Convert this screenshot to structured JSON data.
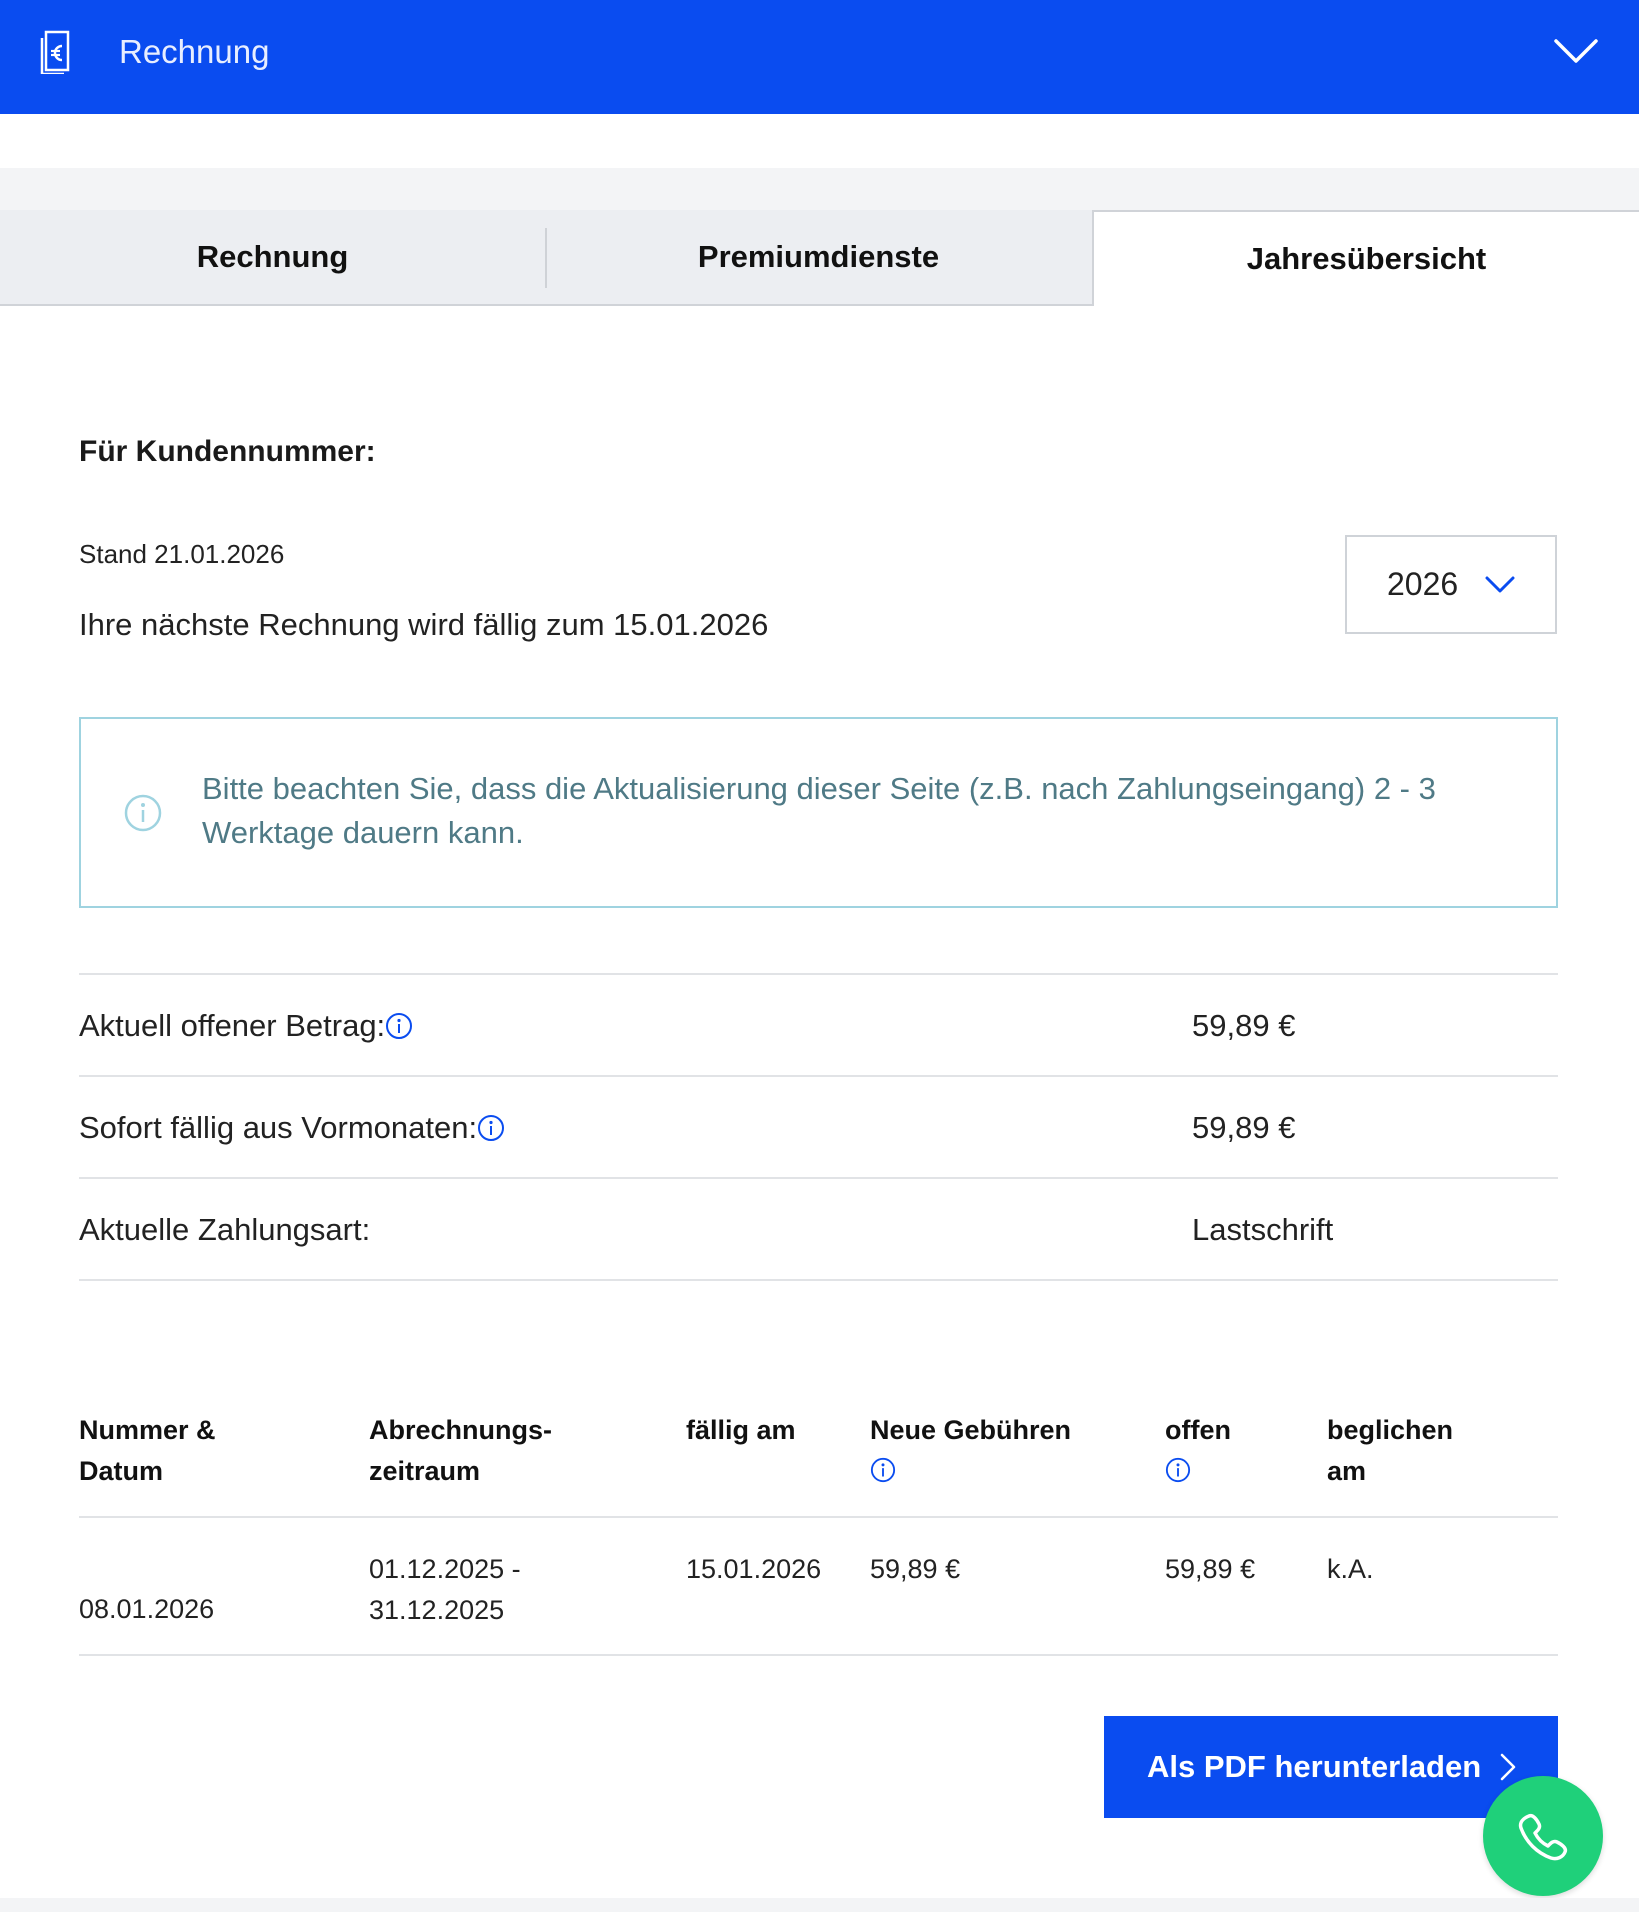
{
  "header": {
    "title": "Rechnung",
    "icon": "invoice-euro-icon",
    "toggle_icon": "chevron-down-icon"
  },
  "tabs": [
    {
      "label": "Rechnung",
      "active": false
    },
    {
      "label": "Premiumdienste",
      "active": false
    },
    {
      "label": "Jahresübersicht",
      "active": true
    }
  ],
  "customer": {
    "label": "Für Kundennummer:"
  },
  "status": {
    "stand": "Stand 21.01.2026",
    "next_invoice": "Ihre nächste Rechnung wird fällig zum 15.01.2026"
  },
  "year_select": {
    "value": "2026"
  },
  "info": {
    "text": "Bitte beachten Sie, dass die Aktualisierung dieser Seite (z.B. nach Zahlungseingang) 2 - 3 Werktage dauern kann."
  },
  "summary": [
    {
      "label": "Aktuell offener Betrag:",
      "value": "59,89 €",
      "has_info": true
    },
    {
      "label": "Sofort fällig aus Vormonaten:",
      "value": "59,89 €",
      "has_info": true
    },
    {
      "label": "Aktuelle Zahlungsart:",
      "value": "Lastschrift",
      "has_info": false
    }
  ],
  "table": {
    "headers": [
      {
        "line1": "Nummer &",
        "line2": "Datum"
      },
      {
        "line1": "Abrechnungs-",
        "line2": "zeitraum"
      },
      {
        "line1": "fällig am",
        "line2": ""
      },
      {
        "line1": "Neue Gebühren",
        "line2": ""
      },
      {
        "line1": "offen",
        "line2": ""
      },
      {
        "line1": "beglichen",
        "line2": "am"
      }
    ],
    "rows": [
      {
        "date": "08.01.2026",
        "period_start": "01.12.2025 -",
        "period_end": "31.12.2025",
        "due": "15.01.2026",
        "new_fees": "59,89 €",
        "open": "59,89 €",
        "paid_on": "k.A."
      }
    ]
  },
  "actions": {
    "pdf_button": "Als PDF herunterladen"
  },
  "colors": {
    "brand_blue": "#0a4cf0",
    "call_green": "#1fd07a",
    "info_teal": "#4f7a86"
  }
}
